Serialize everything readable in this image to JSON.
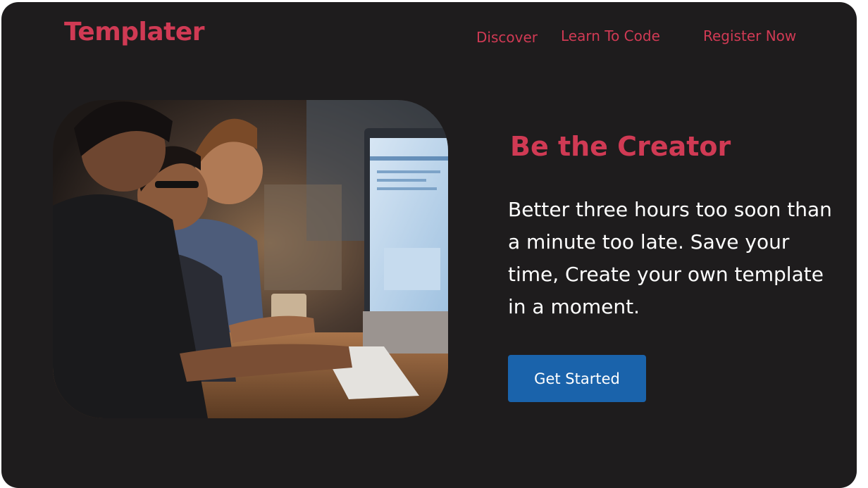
{
  "brand": {
    "name": "Templater",
    "color": "#d03a54"
  },
  "nav": {
    "items": [
      {
        "label": "Discover"
      },
      {
        "label": "Learn To Code"
      },
      {
        "label": "Register Now"
      }
    ]
  },
  "hero": {
    "image": {
      "subject": "developers working at computer monitors"
    },
    "title": "Be the Creator",
    "text": "Better three hours too soon than a minute too late. Save your time, Create your own template in a moment.",
    "cta_label": "Get Started",
    "cta_color": "#1a63ab"
  },
  "colors": {
    "background": "#1e1c1d",
    "text": "#ffffff"
  }
}
